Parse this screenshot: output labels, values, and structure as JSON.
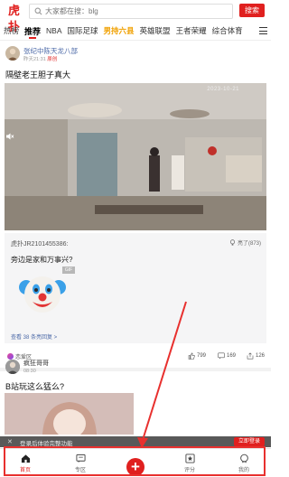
{
  "header": {
    "logo_text": "虎扑",
    "search_placeholder": "大家都在搜：blg",
    "search_button": "搜索"
  },
  "tabs": [
    {
      "label": "热榜"
    },
    {
      "label": "推荐"
    },
    {
      "label": "NBA"
    },
    {
      "label": "国际足球"
    },
    {
      "label": "男持六县"
    },
    {
      "label": "英雄联盟"
    },
    {
      "label": "王者荣耀"
    },
    {
      "label": "综合体育"
    }
  ],
  "post1": {
    "author": "张纪中陈天龙八部",
    "meta": "昨天21:31",
    "meta_badge": "原创",
    "title": "隔壁老王胆子真大",
    "video_timestamp": "2023-10-21",
    "comment": {
      "user": "虎扑JR2101455386:",
      "likes": "亮了(873)",
      "text": "旁边是家和万事兴?",
      "gif_tag": "GIF",
      "more": "查看 38 条亮回复 >"
    },
    "footer": {
      "tag": "恋爱区",
      "likes": "799",
      "comments": "169",
      "shares": "126"
    }
  },
  "post2": {
    "author": "疯狂哥哥",
    "meta": "08:30",
    "title": "B站玩这么猛么?"
  },
  "login_banner": {
    "close": "✕",
    "text": "登录后体验完整功能",
    "button": "立即登录"
  },
  "bottom_nav": {
    "items": [
      {
        "label": "首页"
      },
      {
        "label": "专区"
      },
      {
        "label": "评分"
      },
      {
        "label": "我的"
      }
    ],
    "post_symbol": "+"
  },
  "colors": {
    "brand_red": "#e0201f",
    "annotation_red": "#e8302e"
  }
}
